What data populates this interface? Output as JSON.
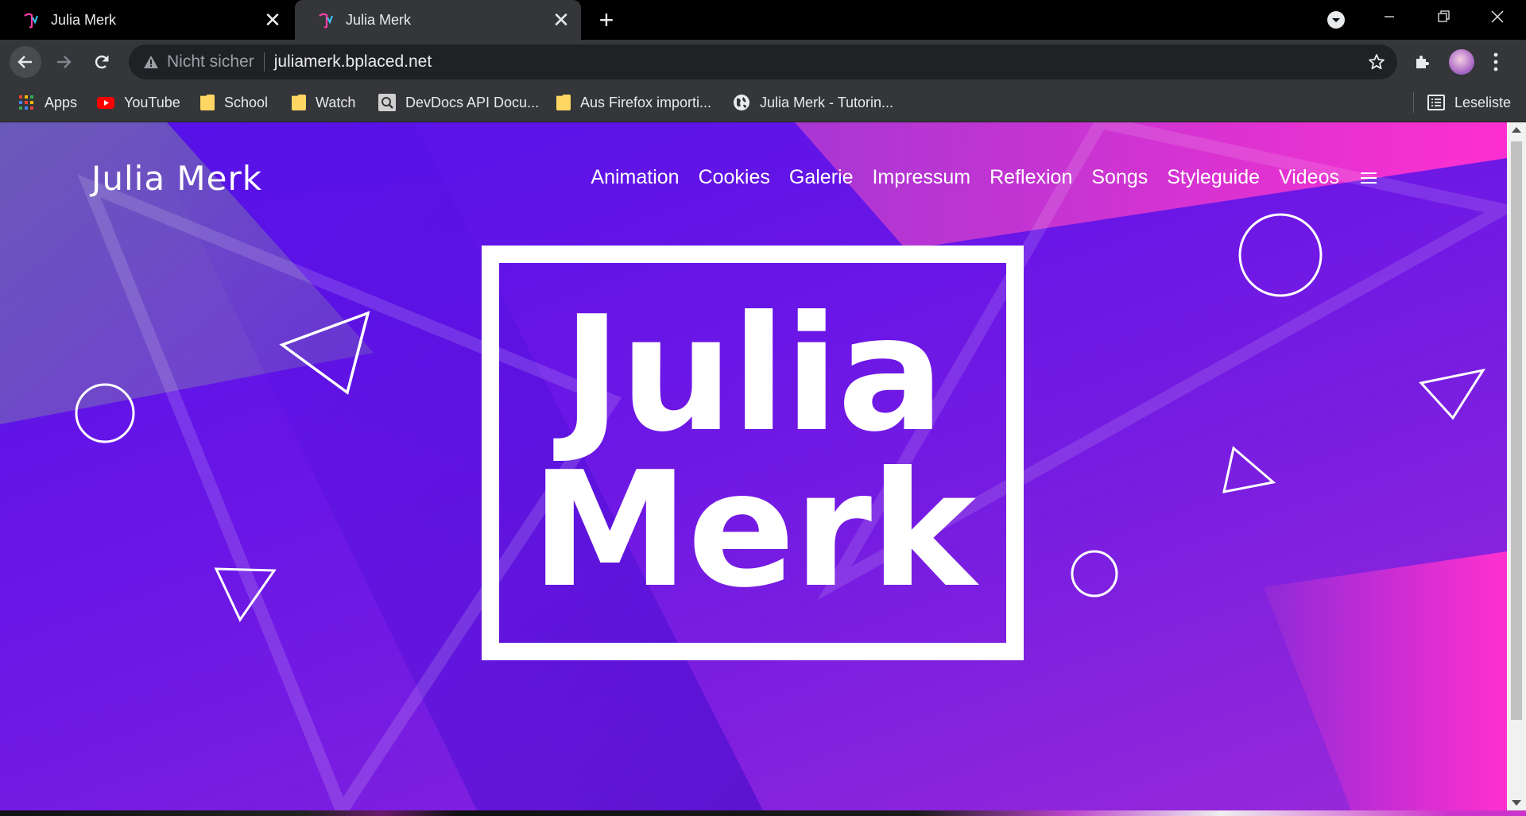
{
  "tabs": [
    {
      "title": "Julia Merk",
      "active": false
    },
    {
      "title": "Julia Merk",
      "active": true
    }
  ],
  "toolbar": {
    "security_label": "Nicht sicher",
    "url": "juliamerk.bplaced.net"
  },
  "bookmarks": [
    {
      "label": "Apps",
      "icon": "apps-grid-icon"
    },
    {
      "label": "YouTube",
      "icon": "youtube-icon"
    },
    {
      "label": "School",
      "icon": "folder-icon"
    },
    {
      "label": "Watch",
      "icon": "folder-icon"
    },
    {
      "label": "DevDocs API Docu...",
      "icon": "devdocs-icon"
    },
    {
      "label": "Aus Firefox importi...",
      "icon": "folder-icon"
    },
    {
      "label": "Julia Merk - Tutorin...",
      "icon": "globe-icon"
    }
  ],
  "reading_list": "Leseliste",
  "site": {
    "brand": "Julia Merk",
    "nav": [
      "Animation",
      "Cookies",
      "Galerie",
      "Impressum",
      "Reflexion",
      "Songs",
      "Styleguide",
      "Videos"
    ],
    "hero": {
      "line1": "Julia",
      "line2": "Merk"
    }
  },
  "colors": {
    "hero_bg": "#5a12e8",
    "accent_pink": "#ff2fd0",
    "text": "#ffffff"
  }
}
